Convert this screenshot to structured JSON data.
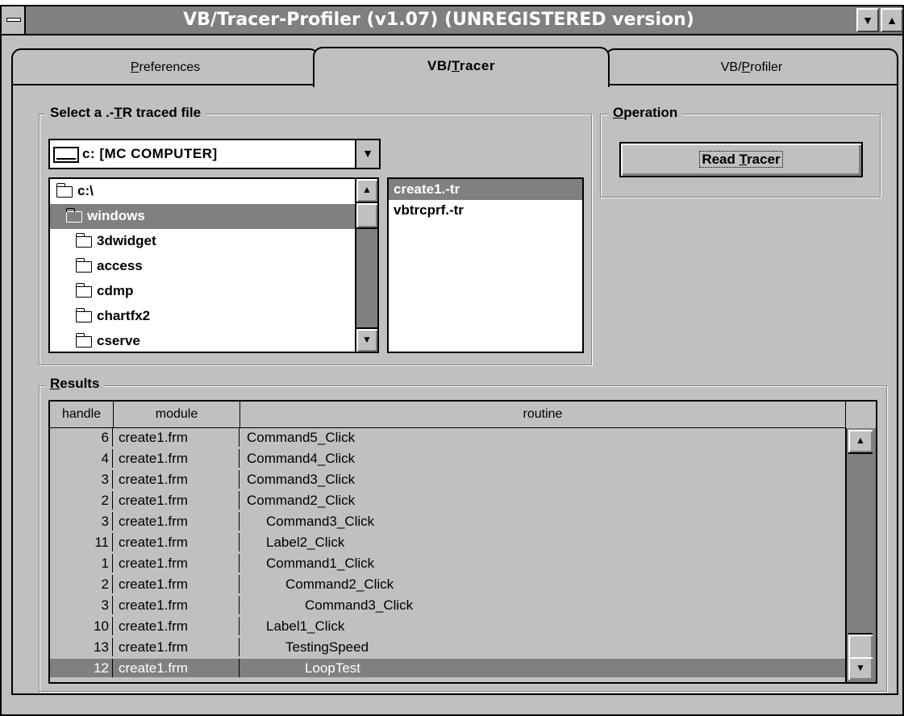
{
  "window": {
    "title": "VB/Tracer-Profiler (v1.07) (UNREGISTERED version)",
    "min_glyph": "▼",
    "max_glyph": "▲"
  },
  "tabs": [
    {
      "pre": "",
      "key": "P",
      "post": "references"
    },
    {
      "pre": "VB/",
      "key": "T",
      "post": "racer"
    },
    {
      "pre": "VB/",
      "key": "P",
      "post": "rofiler"
    }
  ],
  "select_group": {
    "legend_pre": "Select a .-",
    "legend_key": "T",
    "legend_post": "R traced file",
    "drive": "c: [MC COMPUTER]",
    "drive_arrow": "▼",
    "dirs": [
      {
        "name": "c:\\",
        "open": true,
        "indent": 0,
        "selected": false
      },
      {
        "name": "windows",
        "open": true,
        "indent": 1,
        "selected": true
      },
      {
        "name": "3dwidget",
        "open": false,
        "indent": 2,
        "selected": false
      },
      {
        "name": "access",
        "open": false,
        "indent": 2,
        "selected": false
      },
      {
        "name": "cdmp",
        "open": false,
        "indent": 2,
        "selected": false
      },
      {
        "name": "chartfx2",
        "open": false,
        "indent": 2,
        "selected": false
      },
      {
        "name": "cserve",
        "open": false,
        "indent": 2,
        "selected": false
      }
    ],
    "files": [
      {
        "name": "create1.-tr",
        "selected": true
      },
      {
        "name": "vbtrcprf.-tr",
        "selected": false
      }
    ]
  },
  "operation_group": {
    "legend_key": "O",
    "legend_post": "peration",
    "button_pre": "Read ",
    "button_key": "T",
    "button_post": "racer"
  },
  "results": {
    "legend_key": "R",
    "legend_post": "esults",
    "columns": [
      "handle",
      "module",
      "routine"
    ],
    "rows": [
      {
        "handle": "6",
        "module": "create1.frm",
        "routine": "Command5_Click",
        "depth": 0
      },
      {
        "handle": "4",
        "module": "create1.frm",
        "routine": "Command4_Click",
        "depth": 0
      },
      {
        "handle": "3",
        "module": "create1.frm",
        "routine": "Command3_Click",
        "depth": 0
      },
      {
        "handle": "2",
        "module": "create1.frm",
        "routine": "Command2_Click",
        "depth": 0
      },
      {
        "handle": "3",
        "module": "create1.frm",
        "routine": "Command3_Click",
        "depth": 1
      },
      {
        "handle": "11",
        "module": "create1.frm",
        "routine": "Label2_Click",
        "depth": 1
      },
      {
        "handle": "1",
        "module": "create1.frm",
        "routine": "Command1_Click",
        "depth": 1
      },
      {
        "handle": "2",
        "module": "create1.frm",
        "routine": "Command2_Click",
        "depth": 2
      },
      {
        "handle": "3",
        "module": "create1.frm",
        "routine": "Command3_Click",
        "depth": 3
      },
      {
        "handle": "10",
        "module": "create1.frm",
        "routine": "Label1_Click",
        "depth": 1
      },
      {
        "handle": "13",
        "module": "create1.frm",
        "routine": "TestingSpeed",
        "depth": 2
      },
      {
        "handle": "12",
        "module": "create1.frm",
        "routine": "LoopTest",
        "depth": 3,
        "selected": true
      }
    ]
  }
}
